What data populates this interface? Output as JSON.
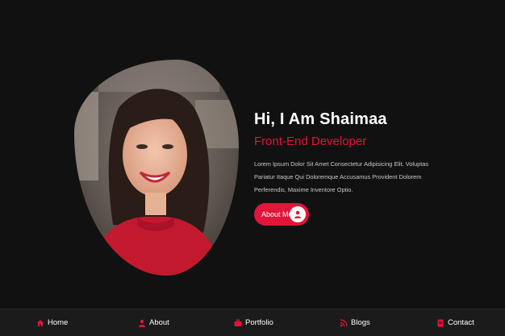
{
  "hero": {
    "greeting": "Hi, I Am Shaimaa",
    "role": "Front-End Developer",
    "description": "Lorem Ipsum Dolor Sit Amet Consectetur Adipisicing Elit. Voluptas Pariatur Itaque Qui Doloremque Accusamus Provident Dolorem Perferendis, Maxime Inventore Optio.",
    "cta_label": "About Me",
    "cta_icon": "user-icon"
  },
  "nav": {
    "items": [
      {
        "label": "Home",
        "icon": "home-icon"
      },
      {
        "label": "About",
        "icon": "user-icon"
      },
      {
        "label": "Portfolio",
        "icon": "briefcase-icon"
      },
      {
        "label": "Blogs",
        "icon": "blog-icon"
      },
      {
        "label": "Contact",
        "icon": "contact-icon"
      }
    ]
  },
  "colors": {
    "background": "#111111",
    "accent": "#e3143a",
    "nav_background": "#1b1b1b",
    "text": "#ffffff"
  }
}
